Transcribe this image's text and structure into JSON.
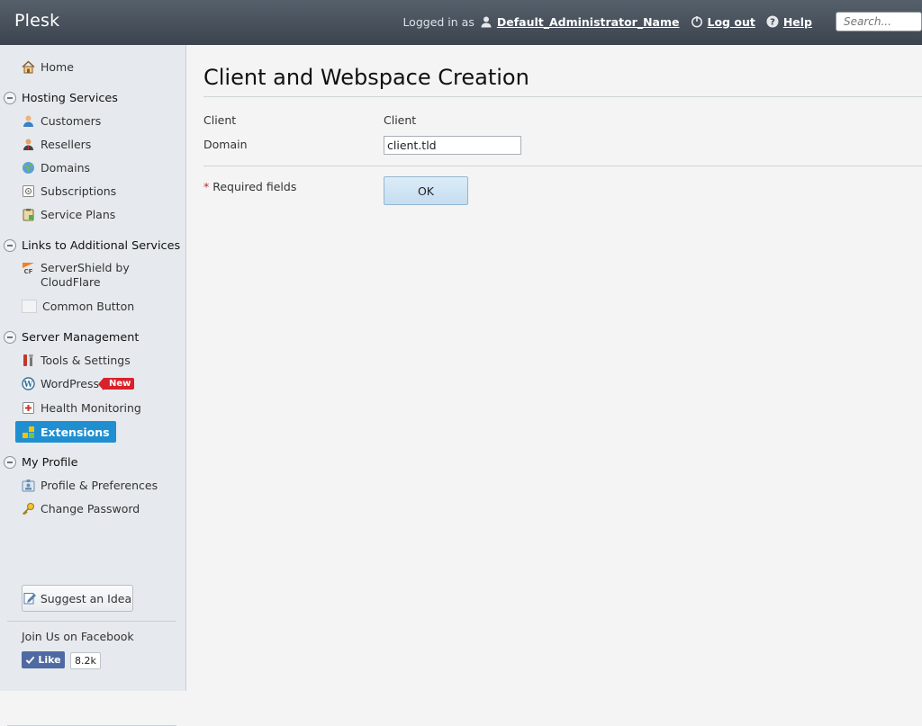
{
  "header": {
    "logo": "Plesk",
    "logged_in_as": "Logged in as",
    "user_name": "Default_Administrator_Name",
    "logout": "Log out",
    "help": "Help",
    "search_placeholder": "Search..."
  },
  "sidebar": {
    "home": "Home",
    "sections": {
      "hosting": "Hosting Services",
      "links": "Links to Additional Services",
      "server": "Server Management",
      "profile": "My Profile"
    },
    "items": {
      "customers": "Customers",
      "resellers": "Resellers",
      "domains": "Domains",
      "subscriptions": "Subscriptions",
      "service_plans": "Service Plans",
      "servershield_l1": "ServerShield by",
      "servershield_l2": "CloudFlare",
      "common_button": "Common Button",
      "tools": "Tools & Settings",
      "wordpress": "WordPress",
      "wordpress_badge": "New",
      "health": "Health Monitoring",
      "extensions": "Extensions",
      "profile_prefs": "Profile & Preferences",
      "change_password": "Change Password"
    },
    "suggest_idea": "Suggest an Idea",
    "facebook_text": "Join Us on Facebook",
    "like_label": "Like",
    "like_count": "8.2k"
  },
  "main": {
    "title": "Client and Webspace Creation",
    "client_label": "Client",
    "client_value": "Client",
    "domain_label": "Domain",
    "domain_value": "client.tld",
    "required_star": "*",
    "required_text": "Required fields",
    "ok_label": "OK"
  },
  "colors": {
    "header_bg": "#3b444e",
    "active_nav": "#1f8fd1",
    "badge_new": "#d8222b",
    "facebook_like": "#4f6aa3"
  }
}
